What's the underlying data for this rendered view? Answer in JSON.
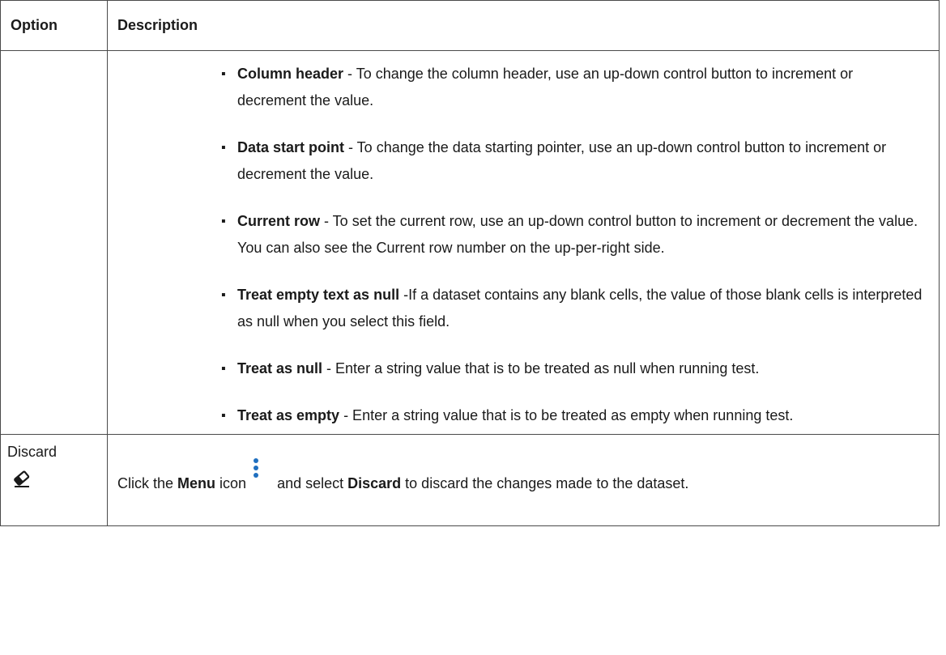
{
  "table": {
    "headers": {
      "option": "Option",
      "description": "Description"
    },
    "bullets": [
      {
        "term": "Column header",
        "text": " - To change the column header, use an up-down control button to increment or decrement the value."
      },
      {
        "term": "Data start point",
        "text": " - To change the data starting pointer, use an up-down control button to increment or decrement the value."
      },
      {
        "term": "Current row",
        "text": " - To set the current row, use an up-down control button to increment or decrement the value. You can also see the Current row number on the up-per-right side."
      },
      {
        "term": "Treat empty text as null",
        "text": " -If a dataset contains any blank cells, the value of those blank cells is interpreted as null when you select this field."
      },
      {
        "term": "Treat as null",
        "text": " - Enter a string value that is to be treated as null when running test."
      },
      {
        "term": "Treat as empty",
        "text": " - Enter a string value that is to be treated as empty when running test."
      }
    ],
    "discard": {
      "option_label": "Discard",
      "option_icon": "eraser-icon",
      "desc_prefix": "Click the ",
      "desc_menu": "Menu",
      "desc_icon_word": " icon",
      "menu_icon": "vertical-ellipsis-icon",
      "desc_and_select": "and select ",
      "desc_discard": "Discard",
      "desc_suffix": " to discard the changes made to the dataset."
    }
  },
  "colors": {
    "menu_icon": "#1f6fbf",
    "border": "#4a4a4a"
  }
}
